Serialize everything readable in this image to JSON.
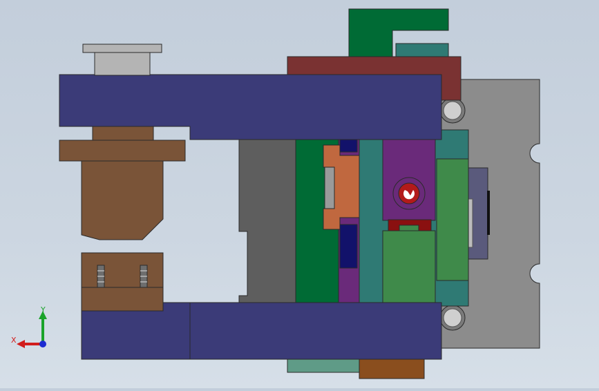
{
  "viewport": {
    "background_top": "#c3cedb",
    "background_bottom": "#d6dfe8"
  },
  "colors": {
    "base_plate": "#8c8c8c",
    "outline": "#2a2a2a",
    "navy_frame": "#3b3b78",
    "brown_parts": "#7a5438",
    "dark_red": "#7a3232",
    "green_dark": "#006b35",
    "teal": "#2f7a74",
    "purple": "#6a2a7a",
    "orange": "#c0683f",
    "light_green": "#3f8a4a",
    "gray_block": "#5e5e5e",
    "slate": "#5a5a7c",
    "mint": "#5f9b87",
    "bronze": "#8a4e1e",
    "axis_x": "#d11d1d",
    "axis_y": "#1aa32a",
    "axis_z": "#1d2bd1"
  },
  "triad": {
    "x_label": "X",
    "y_label": "Y"
  }
}
